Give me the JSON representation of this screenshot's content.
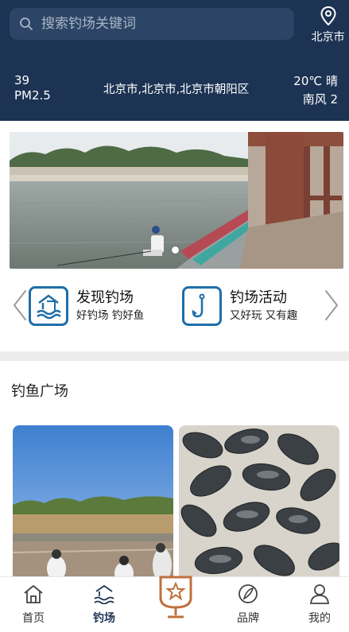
{
  "header": {
    "search_placeholder": "搜索钓场关键词",
    "city": "北京市"
  },
  "weather": {
    "aqi": "39",
    "aqi_label": "PM2.5",
    "location": "北京市,北京市,北京市朝阳区",
    "temp_condition": "20℃ 晴",
    "wind": "南风 2"
  },
  "entries": [
    {
      "title": "发现钓场",
      "subtitle": "好钓场 钓好鱼",
      "icon": "fishing-spot-icon"
    },
    {
      "title": "钓场活动",
      "subtitle": "又好玩 又有趣",
      "icon": "fishing-hook-icon"
    }
  ],
  "section": {
    "title": "钓鱼广场"
  },
  "tabs": [
    {
      "label": "首页",
      "icon": "home-icon"
    },
    {
      "label": "钓场",
      "icon": "fishing-spot-icon"
    },
    {
      "label": "",
      "icon": "trophy-icon"
    },
    {
      "label": "品牌",
      "icon": "brand-icon"
    },
    {
      "label": "我的",
      "icon": "user-icon"
    }
  ],
  "colors": {
    "header_bg": "#1c3353",
    "accent": "#1f6ea8",
    "badge": "#c0703c"
  }
}
